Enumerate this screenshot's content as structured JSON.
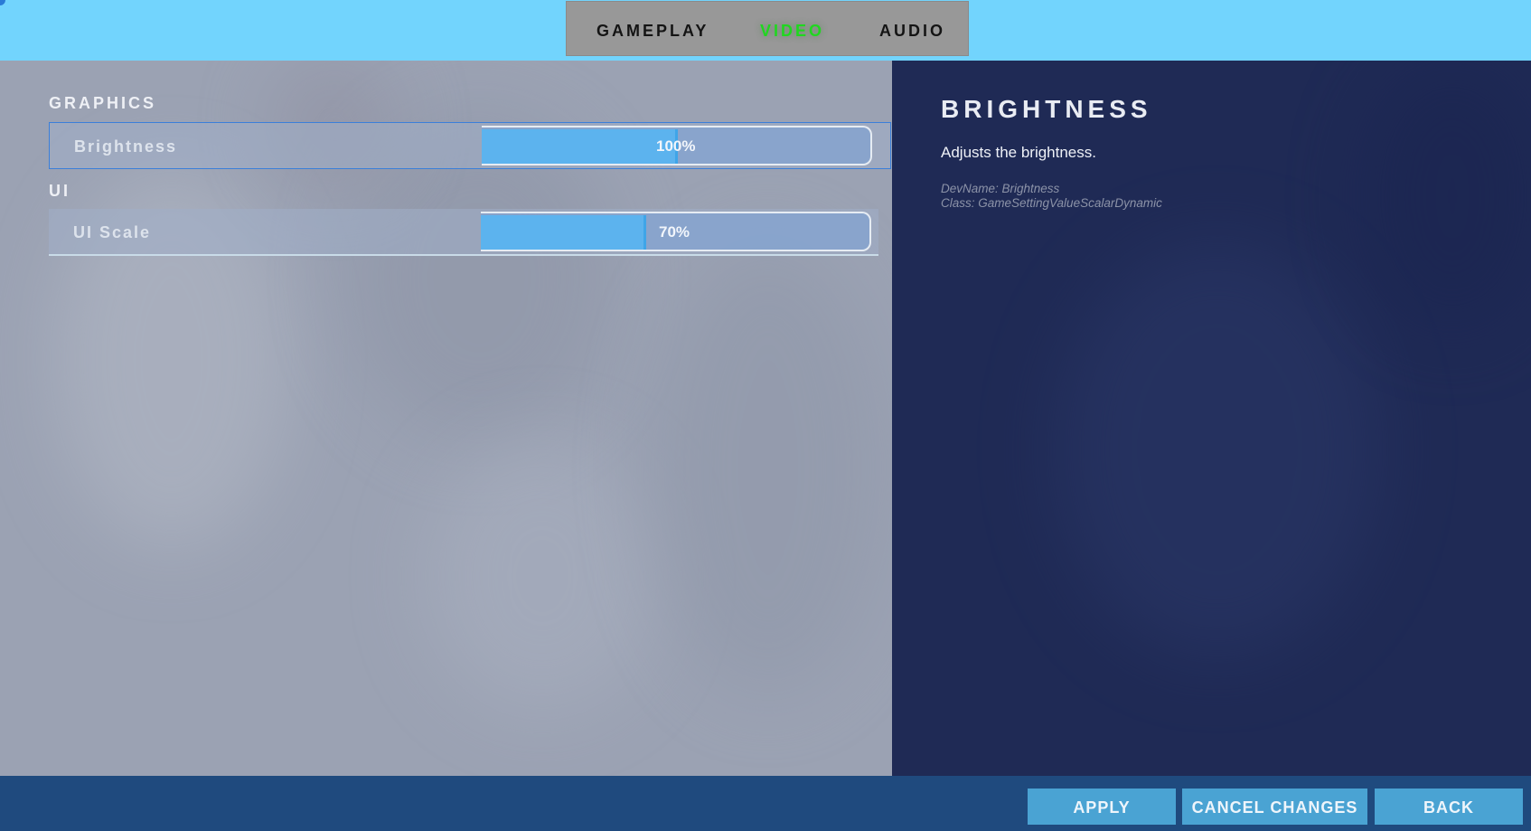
{
  "tabs": [
    {
      "label": "GAMEPLAY",
      "active": false
    },
    {
      "label": "VIDEO",
      "active": true
    },
    {
      "label": "AUDIO",
      "active": false
    }
  ],
  "sections": [
    {
      "header": "GRAPHICS",
      "settings": [
        {
          "label": "Brightness",
          "value_text": "100%",
          "fill_fraction": 0.5,
          "selected": true
        }
      ]
    },
    {
      "header": "UI",
      "settings": [
        {
          "label": "UI Scale",
          "value_text": "70%",
          "fill_fraction": 0.42,
          "selected": false
        }
      ]
    }
  ],
  "detail": {
    "title": "BRIGHTNESS",
    "description": "Adjusts the brightness.",
    "devname": "DevName: Brightness",
    "class": "Class: GameSettingValueScalarDynamic"
  },
  "buttons": {
    "apply": "APPLY",
    "cancel": "CANCEL CHANGES",
    "back": "BACK"
  },
  "colors": {
    "top_bar": "#72d4fd",
    "active_tab": "#1fd81f",
    "left_panel": "#9ba2b3",
    "right_panel": "#1f2a55",
    "bottom_bar": "#1f4a7e",
    "button": "#4aa3d3",
    "slider_fill": "#5cb3ee"
  }
}
